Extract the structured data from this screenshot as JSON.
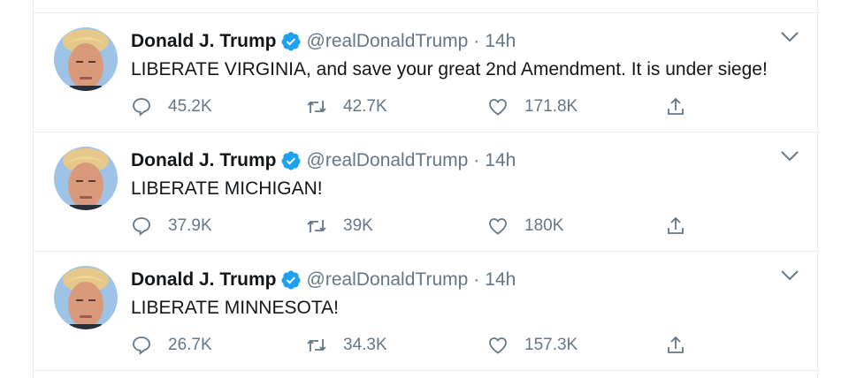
{
  "tweets": [
    {
      "author_name": "Donald J. Trump",
      "handle": "@realDonaldTrump",
      "separator": "·",
      "time": "14h",
      "text": "LIBERATE VIRGINIA, and save your great 2nd Amendment. It is under siege!",
      "replies": "45.2K",
      "retweets": "42.7K",
      "likes": "171.8K"
    },
    {
      "author_name": "Donald J. Trump",
      "handle": "@realDonaldTrump",
      "separator": "·",
      "time": "14h",
      "text": "LIBERATE MICHIGAN!",
      "replies": "37.9K",
      "retweets": "39K",
      "likes": "180K"
    },
    {
      "author_name": "Donald J. Trump",
      "handle": "@realDonaldTrump",
      "separator": "·",
      "time": "14h",
      "text": "LIBERATE MINNESOTA!",
      "replies": "26.7K",
      "retweets": "34.3K",
      "likes": "157.3K"
    }
  ],
  "icons": {
    "verified": "verified-badge-icon",
    "caret": "chevron-down-icon",
    "reply": "reply-icon",
    "retweet": "retweet-icon",
    "like": "heart-icon",
    "share": "share-icon"
  },
  "colors": {
    "brand_blue": "#1da1f2",
    "secondary_text": "#657786",
    "divider": "#e6ecf0"
  }
}
